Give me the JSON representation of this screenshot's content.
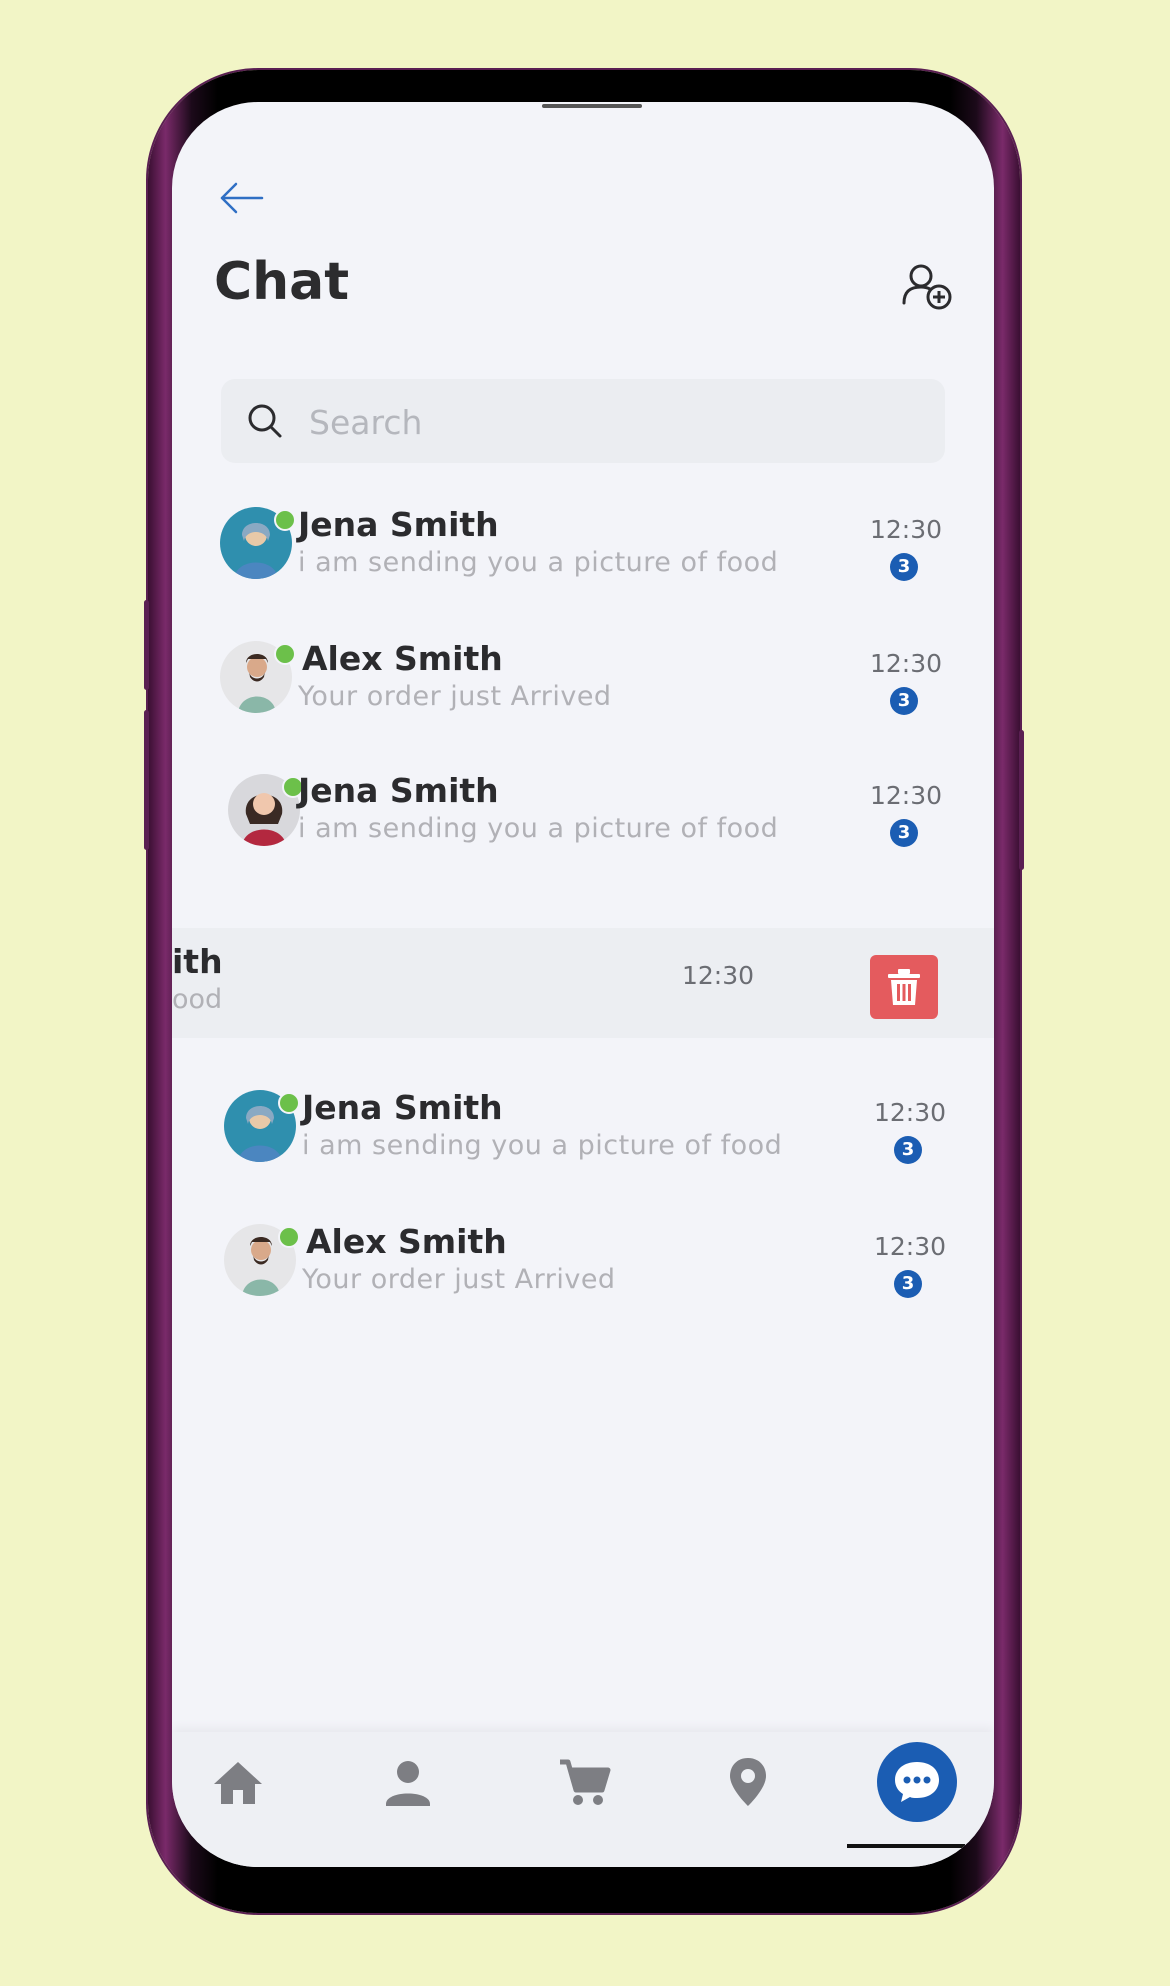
{
  "header": {
    "title": "Chat"
  },
  "search": {
    "placeholder": "Search"
  },
  "chats": [
    {
      "name": "Jena Smith",
      "preview": "i am sending you a  picture of food",
      "time": "12:30",
      "unread": "3"
    },
    {
      "name": "Alex Smith",
      "preview": "Your order just Arrived",
      "time": "12:30",
      "unread": "3"
    },
    {
      "name": "Jena Smith",
      "preview": "i am sending you a  picture of food",
      "time": "12:30",
      "unread": "3"
    },
    {
      "name": "Jena Smith",
      "preview": "i am sending you a  picture of food",
      "time": "12:30",
      "unread": "3"
    },
    {
      "name": "Alex Smith",
      "preview": "Your order just Arrived",
      "time": "12:30",
      "unread": "3"
    }
  ],
  "swiped_chat": {
    "name_fragment": "ith",
    "preview_fragment": "ood",
    "time": "12:30"
  },
  "nav": {
    "items": [
      "home-icon",
      "profile-icon",
      "cart-icon",
      "location-icon",
      "chat-icon"
    ],
    "active": "chat-icon"
  },
  "colors": {
    "accent": "#1b5db3",
    "online": "#6cc04a",
    "delete": "#e45b5e",
    "background": "#f2f5c6"
  }
}
